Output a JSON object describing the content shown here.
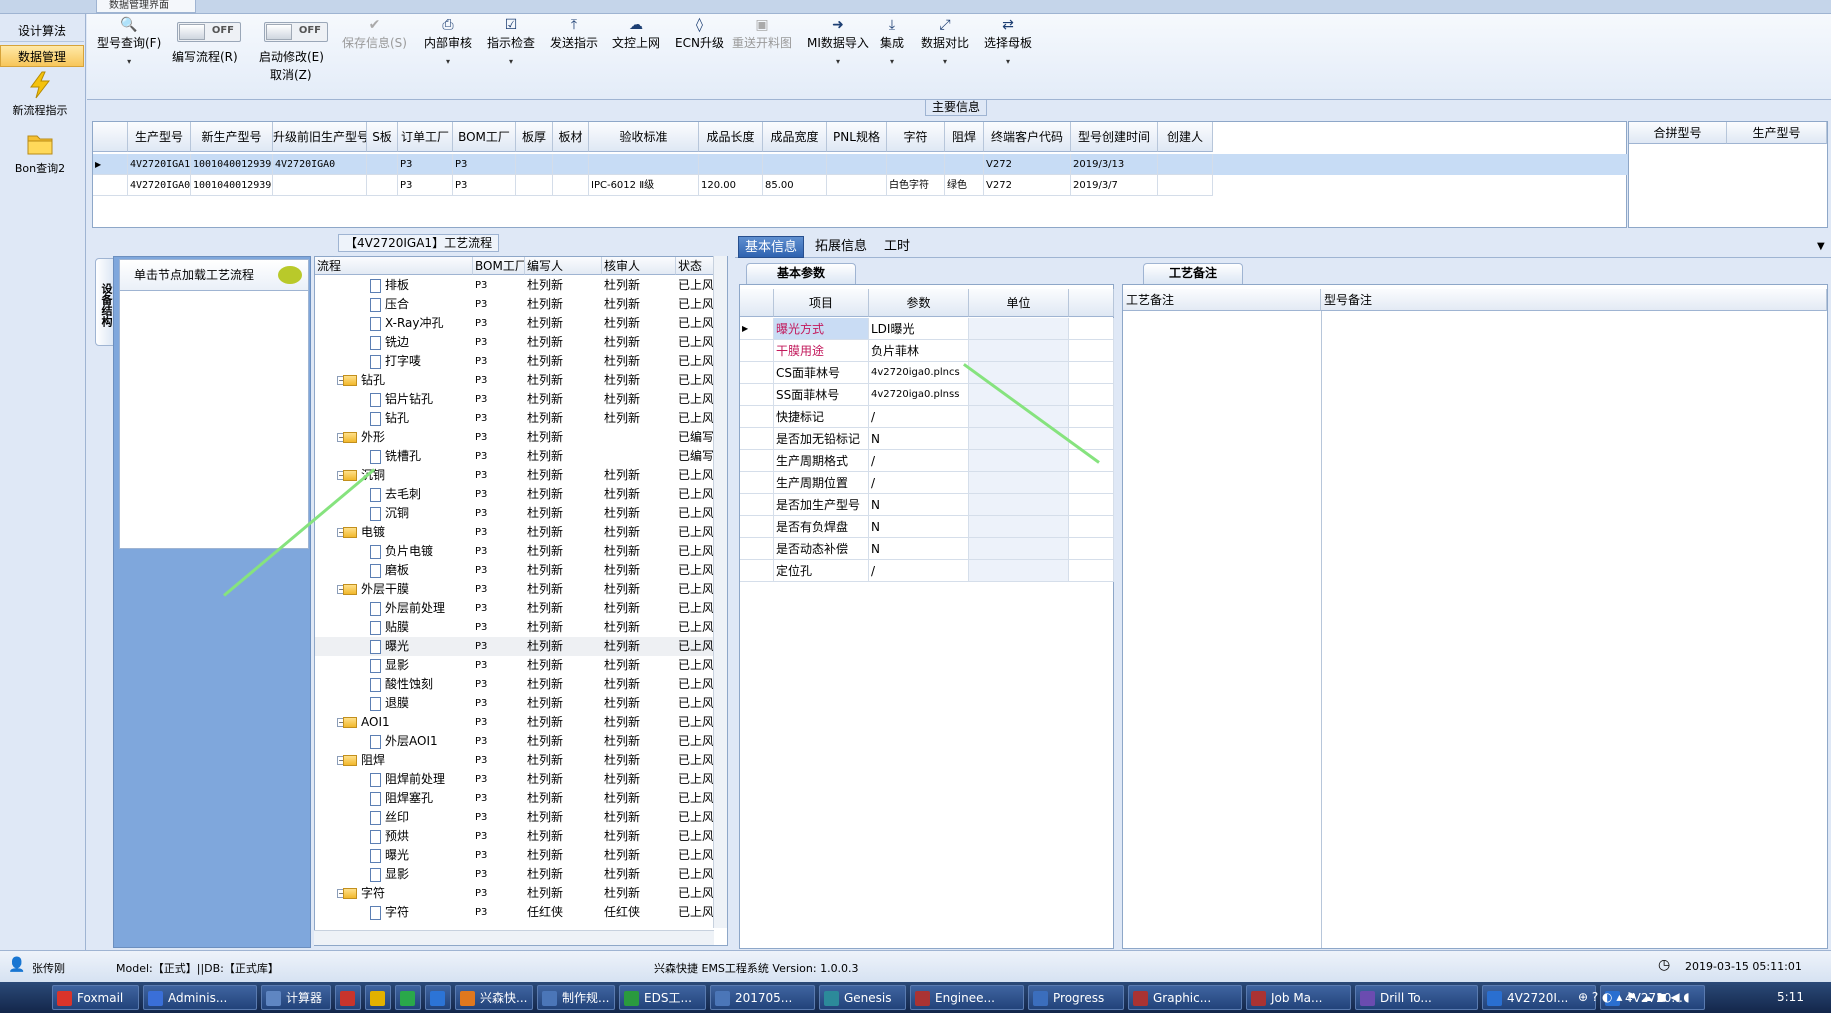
{
  "window": {
    "doc_tab": "数据管理界面"
  },
  "left_nav": {
    "items": [
      {
        "label": "设计算法",
        "active": false
      },
      {
        "label": "数据管理",
        "active": true
      }
    ],
    "icon_items": [
      {
        "label": "新流程指示",
        "icon": "lightning-icon"
      },
      {
        "label": "Bon查询2",
        "icon": "folder-icon"
      }
    ]
  },
  "toolbar": {
    "buttons": [
      {
        "label": "型号查询(F)",
        "icon": "search-icon",
        "dropdown": true,
        "disabled": false
      },
      {
        "label": "保存信息(S)",
        "icon": "check-icon",
        "dropdown": false,
        "disabled": true
      },
      {
        "label": "内部审核",
        "icon": "print-icon",
        "dropdown": true,
        "disabled": false
      },
      {
        "label": "指示检查",
        "icon": "checklist-icon",
        "dropdown": true,
        "disabled": false
      },
      {
        "label": "发送指示",
        "icon": "upload-icon",
        "dropdown": false,
        "disabled": false
      },
      {
        "label": "文控上网",
        "icon": "cloud-upload-icon",
        "dropdown": false,
        "disabled": false
      },
      {
        "label": "ECN升级",
        "icon": "binoculars-icon",
        "dropdown": false,
        "disabled": false
      },
      {
        "label": "重送开料图",
        "icon": "image-icon",
        "dropdown": false,
        "disabled": true
      },
      {
        "label": "MI数据导入",
        "icon": "import-icon",
        "dropdown": true,
        "disabled": false
      },
      {
        "label": "集成",
        "icon": "download-icon",
        "dropdown": true,
        "disabled": false
      },
      {
        "label": "数据对比",
        "icon": "compare-icon",
        "dropdown": true,
        "disabled": false
      },
      {
        "label": "选择母板",
        "icon": "shuffle-icon",
        "dropdown": true,
        "disabled": false
      }
    ],
    "toggles": [
      {
        "label": "编写流程(R)",
        "state": "OFF"
      },
      {
        "label": "启动修改(E)",
        "label2": "取消(Z)",
        "state": "OFF"
      }
    ]
  },
  "main_info": {
    "title": "主要信息",
    "columns": [
      "生产型号",
      "新生产型号",
      "升级前旧生产型号",
      "S板",
      "订单工厂",
      "BOM工厂",
      "板厚",
      "板材",
      "验收标准",
      "成品长度",
      "成品宽度",
      "PNL规格",
      "字符",
      "阻焊",
      "终端客户代码",
      "型号创建时间",
      "创建人"
    ],
    "rows": [
      [
        "4V2720IGA1",
        "10010400129391",
        "4V2720IGA0",
        "",
        "P3",
        "P3",
        "",
        "",
        "",
        "",
        "",
        "",
        "",
        "",
        "V272",
        "2019/3/13",
        ""
      ],
      [
        "4V2720IGA0",
        "10010400129391",
        "",
        "",
        "P3",
        "P3",
        "",
        "",
        "IPC-6012 Ⅱ级",
        "120.00",
        "85.00",
        "",
        "白色字符",
        "绿色",
        "V272",
        "2019/3/7",
        ""
      ]
    ],
    "merge_columns": [
      "合拼型号",
      "生产型号"
    ]
  },
  "flow": {
    "title": "【4V2720IGA1】工艺流程",
    "side_tab": "设备结构",
    "node_hint": "单击节点加载工艺流程",
    "columns": [
      "流程",
      "BOM工厂",
      "编写人",
      "核审人",
      "状态"
    ],
    "rows": [
      {
        "name": "排板",
        "level": 2,
        "folder": false,
        "bom": "P3",
        "writer": "杜列新",
        "reviewer": "杜列新",
        "status": "已上风"
      },
      {
        "name": "压合",
        "level": 2,
        "folder": false,
        "bom": "P3",
        "writer": "杜列新",
        "reviewer": "杜列新",
        "status": "已上风"
      },
      {
        "name": "X-Ray冲孔",
        "level": 2,
        "folder": false,
        "bom": "P3",
        "writer": "杜列新",
        "reviewer": "杜列新",
        "status": "已上风"
      },
      {
        "name": "铣边",
        "level": 2,
        "folder": false,
        "bom": "P3",
        "writer": "杜列新",
        "reviewer": "杜列新",
        "status": "已上风"
      },
      {
        "name": "打字唛",
        "level": 2,
        "folder": false,
        "bom": "P3",
        "writer": "杜列新",
        "reviewer": "杜列新",
        "status": "已上风"
      },
      {
        "name": "钻孔",
        "level": 1,
        "folder": true,
        "bom": "P3",
        "writer": "杜列新",
        "reviewer": "杜列新",
        "status": "已上风"
      },
      {
        "name": "铝片钻孔",
        "level": 2,
        "folder": false,
        "bom": "P3",
        "writer": "杜列新",
        "reviewer": "杜列新",
        "status": "已上风"
      },
      {
        "name": "钻孔",
        "level": 2,
        "folder": false,
        "bom": "P3",
        "writer": "杜列新",
        "reviewer": "杜列新",
        "status": "已上风"
      },
      {
        "name": "外形",
        "level": 1,
        "folder": true,
        "bom": "P3",
        "writer": "杜列新",
        "reviewer": "",
        "status": "已编写"
      },
      {
        "name": "铣槽孔",
        "level": 2,
        "folder": false,
        "bom": "P3",
        "writer": "杜列新",
        "reviewer": "",
        "status": "已编写"
      },
      {
        "name": "沉铜",
        "level": 1,
        "folder": true,
        "bom": "P3",
        "writer": "杜列新",
        "reviewer": "杜列新",
        "status": "已上风"
      },
      {
        "name": "去毛刺",
        "level": 2,
        "folder": false,
        "bom": "P3",
        "writer": "杜列新",
        "reviewer": "杜列新",
        "status": "已上风"
      },
      {
        "name": "沉铜",
        "level": 2,
        "folder": false,
        "bom": "P3",
        "writer": "杜列新",
        "reviewer": "杜列新",
        "status": "已上风"
      },
      {
        "name": "电镀",
        "level": 1,
        "folder": true,
        "bom": "P3",
        "writer": "杜列新",
        "reviewer": "杜列新",
        "status": "已上风"
      },
      {
        "name": "负片电镀",
        "level": 2,
        "folder": false,
        "bom": "P3",
        "writer": "杜列新",
        "reviewer": "杜列新",
        "status": "已上风"
      },
      {
        "name": "磨板",
        "level": 2,
        "folder": false,
        "bom": "P3",
        "writer": "杜列新",
        "reviewer": "杜列新",
        "status": "已上风"
      },
      {
        "name": "外层干膜",
        "level": 1,
        "folder": true,
        "bom": "P3",
        "writer": "杜列新",
        "reviewer": "杜列新",
        "status": "已上风"
      },
      {
        "name": "外层前处理",
        "level": 2,
        "folder": false,
        "bom": "P3",
        "writer": "杜列新",
        "reviewer": "杜列新",
        "status": "已上风"
      },
      {
        "name": "贴膜",
        "level": 2,
        "folder": false,
        "bom": "P3",
        "writer": "杜列新",
        "reviewer": "杜列新",
        "status": "已上风"
      },
      {
        "name": "曝光",
        "level": 2,
        "folder": false,
        "bom": "P3",
        "writer": "杜列新",
        "reviewer": "杜列新",
        "status": "已上风",
        "selected": true
      },
      {
        "name": "显影",
        "level": 2,
        "folder": false,
        "bom": "P3",
        "writer": "杜列新",
        "reviewer": "杜列新",
        "status": "已上风"
      },
      {
        "name": "酸性蚀刻",
        "level": 2,
        "folder": false,
        "bom": "P3",
        "writer": "杜列新",
        "reviewer": "杜列新",
        "status": "已上风"
      },
      {
        "name": "退膜",
        "level": 2,
        "folder": false,
        "bom": "P3",
        "writer": "杜列新",
        "reviewer": "杜列新",
        "status": "已上风"
      },
      {
        "name": "AOI1",
        "level": 1,
        "folder": true,
        "bom": "P3",
        "writer": "杜列新",
        "reviewer": "杜列新",
        "status": "已上风"
      },
      {
        "name": "外层AOI1",
        "level": 2,
        "folder": false,
        "bom": "P3",
        "writer": "杜列新",
        "reviewer": "杜列新",
        "status": "已上风"
      },
      {
        "name": "阻焊",
        "level": 1,
        "folder": true,
        "bom": "P3",
        "writer": "杜列新",
        "reviewer": "杜列新",
        "status": "已上风"
      },
      {
        "name": "阻焊前处理",
        "level": 2,
        "folder": false,
        "bom": "P3",
        "writer": "杜列新",
        "reviewer": "杜列新",
        "status": "已上风"
      },
      {
        "name": "阻焊塞孔",
        "level": 2,
        "folder": false,
        "bom": "P3",
        "writer": "杜列新",
        "reviewer": "杜列新",
        "status": "已上风"
      },
      {
        "name": "丝印",
        "level": 2,
        "folder": false,
        "bom": "P3",
        "writer": "杜列新",
        "reviewer": "杜列新",
        "status": "已上风"
      },
      {
        "name": "预烘",
        "level": 2,
        "folder": false,
        "bom": "P3",
        "writer": "杜列新",
        "reviewer": "杜列新",
        "status": "已上风"
      },
      {
        "name": "曝光",
        "level": 2,
        "folder": false,
        "bom": "P3",
        "writer": "杜列新",
        "reviewer": "杜列新",
        "status": "已上风"
      },
      {
        "name": "显影",
        "level": 2,
        "folder": false,
        "bom": "P3",
        "writer": "杜列新",
        "reviewer": "杜列新",
        "status": "已上风"
      },
      {
        "name": "字符",
        "level": 1,
        "folder": true,
        "bom": "P3",
        "writer": "杜列新",
        "reviewer": "杜列新",
        "status": "已上风"
      },
      {
        "name": "字符",
        "level": 2,
        "folder": false,
        "bom": "P3",
        "writer": "任红侠",
        "reviewer": "任红侠",
        "status": "已上风"
      }
    ]
  },
  "detail_tabs": [
    "基本信息",
    "拓展信息",
    "工时"
  ],
  "basic_params": {
    "tab": "基本参数",
    "columns": [
      "项目",
      "参数",
      "单位"
    ],
    "rows": [
      {
        "item": "曝光方式",
        "value": "LDI曝光",
        "highlight": true
      },
      {
        "item": "干膜用途",
        "value": "负片菲林",
        "highlight": true
      },
      {
        "item": "CS面菲林号",
        "value": "4v2720iga0.plncs",
        "highlight": false
      },
      {
        "item": "SS面菲林号",
        "value": "4v2720iga0.plnss",
        "highlight": false
      },
      {
        "item": "快捷标记",
        "value": "/",
        "highlight": false
      },
      {
        "item": "是否加无铅标记",
        "value": "N",
        "highlight": false
      },
      {
        "item": "生产周期格式",
        "value": "/",
        "highlight": false
      },
      {
        "item": "生产周期位置",
        "value": "/",
        "highlight": false
      },
      {
        "item": "是否加生产型号",
        "value": "N",
        "highlight": false
      },
      {
        "item": "是否有负焊盘",
        "value": "N",
        "highlight": false
      },
      {
        "item": "是否动态补偿",
        "value": "N",
        "highlight": false
      },
      {
        "item": "定位孔",
        "value": "/",
        "highlight": false
      }
    ]
  },
  "remarks": {
    "tab": "工艺备注",
    "columns": [
      "工艺备注",
      "型号备注"
    ]
  },
  "status_bar": {
    "user": "张传刚",
    "model_db": "Model:【正式】||DB:【正式库】",
    "app": "兴森快捷 EMS工程系统 Version: 1.0.0.3",
    "datetime": "2019-03-15 05:11:01"
  },
  "taskbar": {
    "tasks": [
      "Foxmail",
      "Adminis...",
      "计算器",
      "",
      "",
      "",
      "",
      "兴森快...",
      "制作规...",
      "EDS工...",
      "201705...",
      "Genesis",
      "Enginee...",
      "Progress",
      "Graphic...",
      "Job Ma...",
      "Drill To...",
      "4V2720I...",
      "4V2720..."
    ],
    "clock": "5:11"
  },
  "colors": {
    "accent": "#2f63b0",
    "selected_row": "#c7dcf5",
    "highlight_text": "#c2185b",
    "arrow": "#86e37e"
  }
}
